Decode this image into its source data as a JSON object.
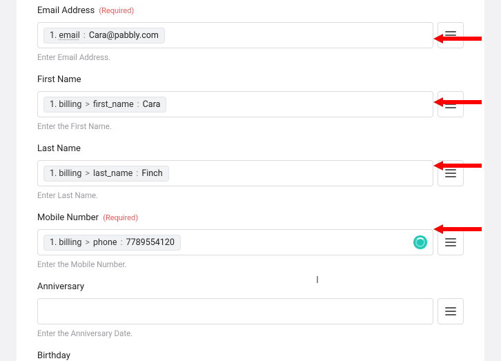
{
  "fields": {
    "email": {
      "label": "Email Address",
      "required_text": "(Required)",
      "tag_step": "1.",
      "tag_path": "email",
      "tag_value": "Cara@pabbly.com",
      "helper": "Enter Email Address."
    },
    "first_name": {
      "label": "First Name",
      "tag_step": "1.",
      "tag_path1": "billing",
      "tag_path2": "first_name",
      "tag_value": "Cara",
      "helper": "Enter the First Name."
    },
    "last_name": {
      "label": "Last Name",
      "tag_step": "1.",
      "tag_path1": "billing",
      "tag_path2": "last_name",
      "tag_value": "Finch",
      "helper": "Enter Last Name."
    },
    "mobile": {
      "label": "Mobile Number",
      "required_text": "(Required)",
      "tag_step": "1.",
      "tag_path1": "billing",
      "tag_path2": "phone",
      "tag_value": "7789554120",
      "helper": "Enter the Mobile Number."
    },
    "anniversary": {
      "label": "Anniversary",
      "helper": "Enter the Anniversary Date."
    },
    "birthday": {
      "label": "Birthday"
    }
  },
  "arrow_color": "#ff0000"
}
